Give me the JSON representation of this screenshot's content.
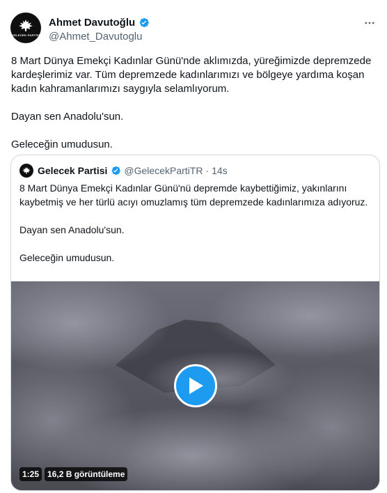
{
  "author": {
    "display_name": "Ahmet Davutoğlu",
    "handle": "@Ahmet_Davutoglu",
    "avatar_text": "GELECEK PARTİSİ"
  },
  "tweet": {
    "text": "8 Mart Dünya Emekçi Kadınlar Günü'nde aklımızda, yüreğimizde depremzede kardeşlerimiz var.  Tüm depremzede kadınlarımızı ve bölgeye yardıma koşan kadın kahramanlarımızı saygıyla selamlıyorum.\n\nDayan sen Anadolu'sun.\n\nGeleceğin umudusun."
  },
  "quote": {
    "display_name": "Gelecek Partisi",
    "handle": "@GelecekPartiTR",
    "separator": "·",
    "time": "14s",
    "text": "8 Mart Dünya Emekçi Kadınlar Günü'nü depremde kaybettiğimiz, yakınlarını kaybetmiş ve her türlü acıyı omuzlamış tüm depremzede kadınlarımıza adıyoruz.\n\nDayan sen Anadolu'sun.\n\nGeleceğin umudusun.",
    "video": {
      "duration": "1:25",
      "views": "16,2 B görüntüleme"
    }
  },
  "colors": {
    "verified": "#1d9bf0",
    "play_button": "#1d9bf0",
    "secondary_text": "#536471",
    "border": "#cfd9de"
  },
  "icons": [
    "verified-badge-icon",
    "more-options-icon",
    "play-icon",
    "party-logo-icon"
  ]
}
